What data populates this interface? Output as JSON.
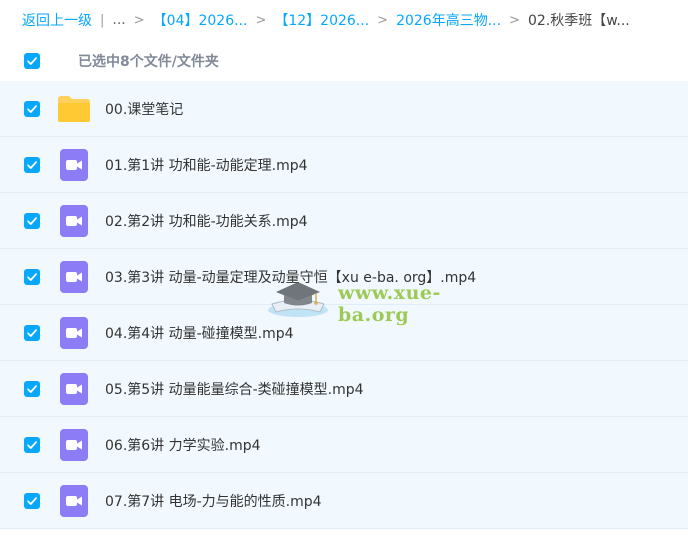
{
  "breadcrumb": {
    "back": "返回上一级",
    "ellipsis": "...",
    "items": [
      "【04】2026...",
      "【12】2026...",
      "2026年高三物..."
    ],
    "current": "02.秋季班【w..."
  },
  "selection": {
    "label": "已选中8个文件/文件夹"
  },
  "files": [
    {
      "name": "00.课堂笔记",
      "type": "folder"
    },
    {
      "name": "01.第1讲 功和能-动能定理.mp4",
      "type": "video"
    },
    {
      "name": "02.第2讲 功和能-功能关系.mp4",
      "type": "video"
    },
    {
      "name": "03.第3讲 动量-动量定理及动量守恒【xu e-ba. org】.mp4",
      "type": "video"
    },
    {
      "name": "04.第4讲 动量-碰撞模型.mp4",
      "type": "video"
    },
    {
      "name": "05.第5讲 动量能量综合-类碰撞模型.mp4",
      "type": "video"
    },
    {
      "name": "06.第6讲 力学实验.mp4",
      "type": "video"
    },
    {
      "name": "07.第7讲 电场-力与能的性质.mp4",
      "type": "video"
    }
  ],
  "watermark": {
    "text": "www.xue-ba.org"
  },
  "colors": {
    "accent": "#06a7ff",
    "row_bg": "#f1f9fe",
    "video_icon": "#8c7cf5",
    "folder_icon": "#ffd15c"
  }
}
